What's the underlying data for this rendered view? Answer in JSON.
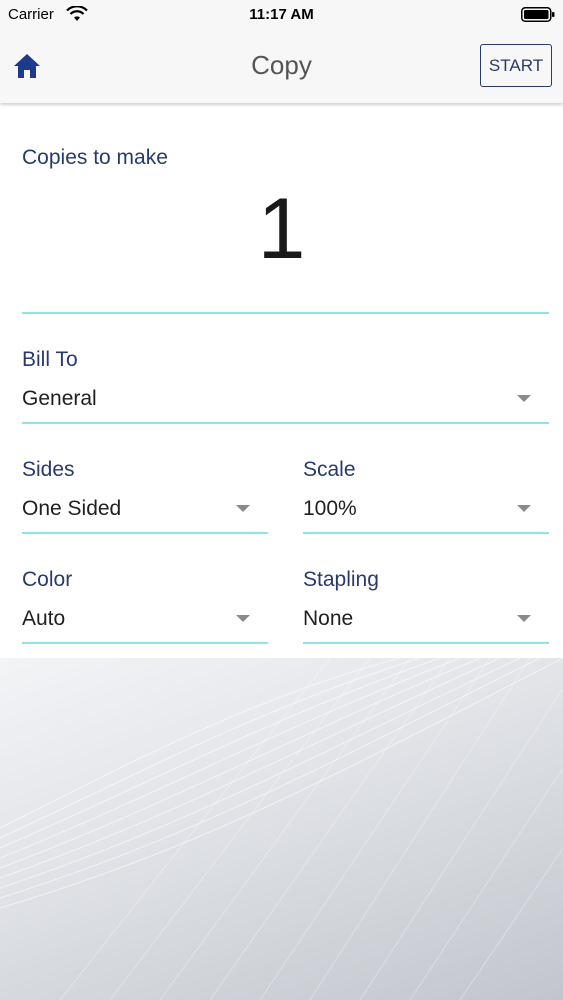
{
  "status_bar": {
    "carrier": "Carrier",
    "time": "11:17 AM"
  },
  "nav": {
    "title": "Copy",
    "start_label": "START",
    "home_icon": "home-icon"
  },
  "copies": {
    "label": "Copies to make",
    "value": "1"
  },
  "bill_to": {
    "label": "Bill To",
    "value": "General"
  },
  "sides": {
    "label": "Sides",
    "value": "One Sided"
  },
  "scale": {
    "label": "Scale",
    "value": "100%"
  },
  "color": {
    "label": "Color",
    "value": "Auto"
  },
  "stapling": {
    "label": "Stapling",
    "value": "None"
  },
  "colors": {
    "accent": "#2a3a6b",
    "underline": "#8fe3e6"
  }
}
